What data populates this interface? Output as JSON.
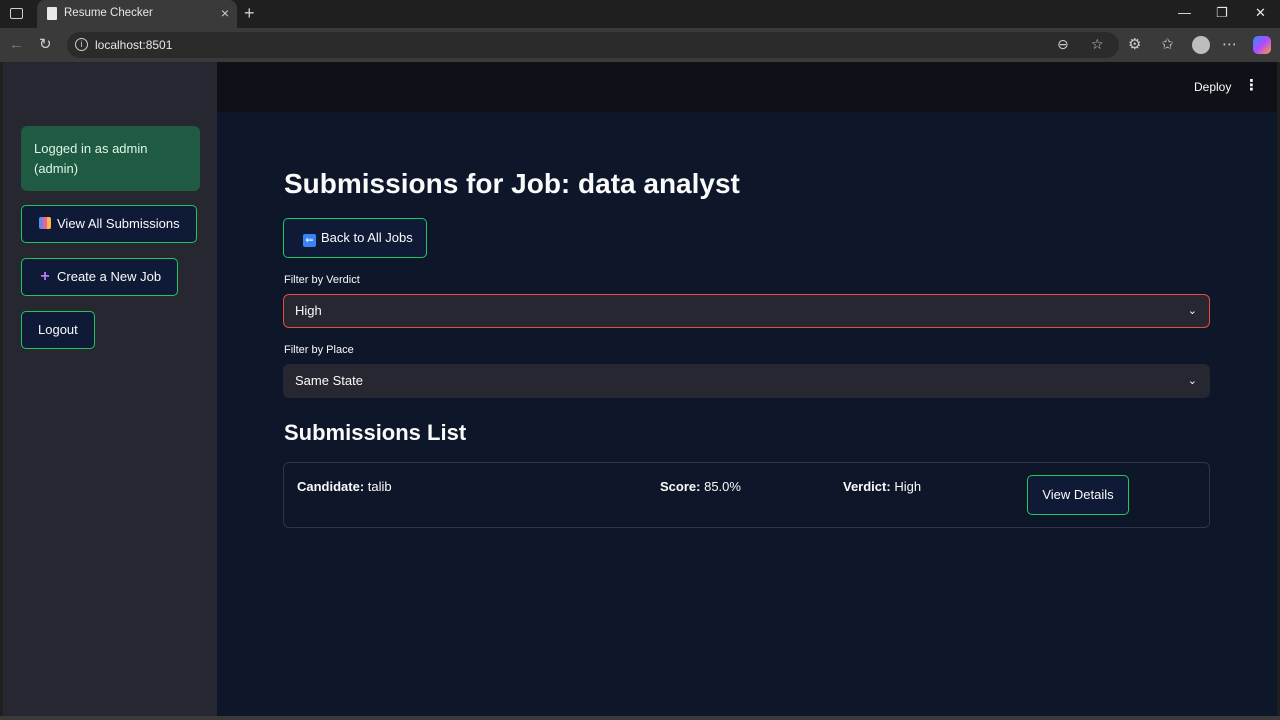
{
  "browser": {
    "tab_title": "Resume Checker",
    "url": "localhost:8501"
  },
  "header": {
    "deploy_label": "Deploy"
  },
  "sidebar": {
    "login_text": "Logged in as admin (admin)",
    "buttons": [
      {
        "label": "View All Submissions",
        "icon": "bar-chart-icon"
      },
      {
        "label": "Create a New Job",
        "icon": "plus-icon"
      },
      {
        "label": "Logout",
        "icon": ""
      }
    ]
  },
  "main": {
    "title": "Submissions for Job: data analyst",
    "back_label": "Back to All Jobs",
    "filter_verdict": {
      "label": "Filter by Verdict",
      "value": "High"
    },
    "filter_place": {
      "label": "Filter by Place",
      "value": "Same State"
    },
    "list_title": "Submissions List",
    "submissions": [
      {
        "candidate_label": "Candidate:",
        "candidate": "talib",
        "score_label": "Score:",
        "score": "85.0%",
        "verdict_label": "Verdict:",
        "verdict": "High",
        "button": "View Details"
      }
    ]
  },
  "colors": {
    "accent_border": "#22c55e",
    "active_select_border": "#e74b3c",
    "success_box": "#1f5a43"
  }
}
